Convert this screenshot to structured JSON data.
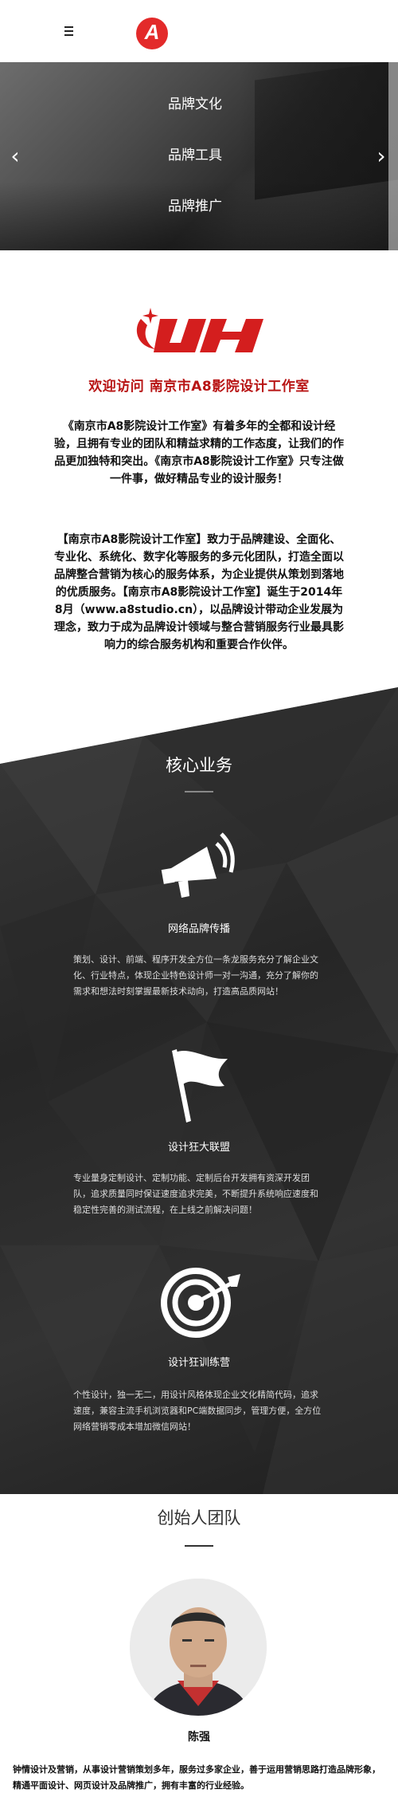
{
  "header": {
    "menu_icon": "hamburger-menu-icon",
    "logo_letter": "A",
    "logo_color": "#e32a2a"
  },
  "banner": {
    "menu_items": [
      "品牌文化",
      "品牌工具",
      "品牌推广"
    ],
    "prev_icon": "chevron-left-icon",
    "next_icon": "chevron-right-icon"
  },
  "intro": {
    "title": "欢迎访问 南京市A8影院设计工作室",
    "paragraph1": "《南京市A8影院设计工作室》有着多年的全都和设计经验，且拥有专业的团队和精益求精的工作态度，让我们的作品更加独特和突出。《南京市A8影院设计工作室》只专注做一件事，做好精品专业的设计服务！",
    "paragraph2": "【南京市A8影院设计工作室】致力于品牌建设、全面化、专业化、系统化、数字化等服务的多元化团队，打造全面以品牌整合营销为核心的服务体系，为企业提供从策划到落地的优质服务。【南京市A8影院设计工作室】诞生于2014年8月（www.a8studio.cn），以品牌设计带动企业发展为理念，致力于成为品牌设计领域与整合营销服务行业最具影响力的综合服务机构和重要合作伙伴。",
    "accent_color": "#b81414"
  },
  "core": {
    "title": "核心业务",
    "divider_color": "#888888",
    "items": [
      {
        "icon": "megaphone-icon",
        "name": "网络品牌传播",
        "desc": "策划、设计、前端、程序开发全方位一条龙服务充分了解企业文化、行业特点，体现企业特色设计师一对一沟通，充分了解你的需求和想法时刻掌握最新技术动向，打造高品质网站！"
      },
      {
        "icon": "flag-icon",
        "name": "设计狂大联盟",
        "desc": "专业量身定制设计、定制功能、定制后台开发拥有资深开发团队，追求质量同时保证速度追求完美，不断提升系统响应速度和稳定性完善的测试流程，在上线之前解决问题！"
      },
      {
        "icon": "target-arrow-icon",
        "name": "设计狂训练营",
        "desc": "个性设计，独一无二，用设计风格体现企业文化精简代码，追求速度，兼容主流手机浏览器和PC端数据同步，管理方便，全方位网络营销零成本增加微信网站！"
      }
    ]
  },
  "team": {
    "title": "创始人团队",
    "divider_color": "#333333",
    "member_name": "陈强",
    "member_desc": "钟情设计及营销，从事设计营销策划多年，服务过多家企业，善于运用营销思路打造品牌形象，精通平面设计、网页设计及品牌推广，拥有丰富的行业经验。"
  }
}
